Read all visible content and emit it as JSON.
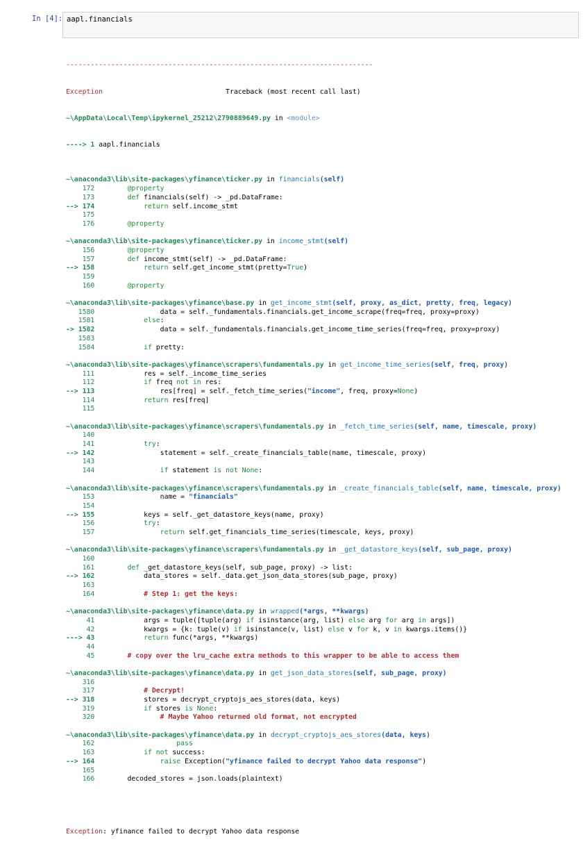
{
  "cell": {
    "prompt": "In [4]:",
    "input": "aapl.financials"
  },
  "traceback": {
    "separator": "---------------------------------------------------------------------------",
    "exception_name": "Exception",
    "traceback_header": "Traceback (most recent call last)",
    "first": {
      "path": "~\\AppData\\Local\\Temp\\ipykernel_25212\\2790889649.py",
      "in_word": " in ",
      "module": "<module>",
      "line": "----> 1 aapl.financials"
    },
    "frames": [
      {
        "path": "~\\anaconda3\\lib\\site-packages\\yfinance\\ticker.py",
        "func": "financials",
        "args": "(self)",
        "lines": [
          {
            "num": "    172",
            "code": "        @property"
          },
          {
            "num": "    173",
            "code": "        def financials(self) -> _pd.DataFrame:"
          },
          {
            "num": "--> 174",
            "code": "            return self.income_stmt",
            "current": true
          },
          {
            "num": "    175",
            "code": ""
          },
          {
            "num": "    176",
            "code": "        @property"
          }
        ]
      },
      {
        "path": "~\\anaconda3\\lib\\site-packages\\yfinance\\ticker.py",
        "func": "income_stmt",
        "args": "(self)",
        "lines": [
          {
            "num": "    156",
            "code": "        @property"
          },
          {
            "num": "    157",
            "code": "        def income_stmt(self) -> _pd.DataFrame:"
          },
          {
            "num": "--> 158",
            "code": "            return self.get_income_stmt(pretty=True)",
            "current": true
          },
          {
            "num": "    159",
            "code": ""
          },
          {
            "num": "    160",
            "code": "        @property"
          }
        ]
      },
      {
        "path": "~\\anaconda3\\lib\\site-packages\\yfinance\\base.py",
        "func": "get_income_stmt",
        "args": "(self, proxy, as_dict, pretty, freq, legacy)",
        "lines": [
          {
            "num": "   1580",
            "code": "                data = self._fundamentals.financials.get_income_scrape(freq=freq, proxy=proxy)"
          },
          {
            "num": "   1581",
            "code": "            else:"
          },
          {
            "num": "-> 1582",
            "code": "                data = self._fundamentals.financials.get_income_time_series(freq=freq, proxy=proxy)",
            "current": true
          },
          {
            "num": "   1583",
            "code": ""
          },
          {
            "num": "   1584",
            "code": "            if pretty:"
          }
        ]
      },
      {
        "path": "~\\anaconda3\\lib\\site-packages\\yfinance\\scrapers\\fundamentals.py",
        "func": "get_income_time_series",
        "args": "(self, freq, proxy)",
        "lines": [
          {
            "num": "    111",
            "code": "            res = self._income_time_series"
          },
          {
            "num": "    112",
            "code": "            if freq not in res:"
          },
          {
            "num": "--> 113",
            "code": "                res[freq] = self._fetch_time_series(\"income\", freq, proxy=None)",
            "current": true
          },
          {
            "num": "    114",
            "code": "            return res[freq]"
          },
          {
            "num": "    115",
            "code": ""
          }
        ]
      },
      {
        "path": "~\\anaconda3\\lib\\site-packages\\yfinance\\scrapers\\fundamentals.py",
        "func": "_fetch_time_series",
        "args": "(self, name, timescale, proxy)",
        "lines": [
          {
            "num": "    140",
            "code": ""
          },
          {
            "num": "    141",
            "code": "            try:"
          },
          {
            "num": "--> 142",
            "code": "                statement = self._create_financials_table(name, timescale, proxy)",
            "current": true
          },
          {
            "num": "    143",
            "code": ""
          },
          {
            "num": "    144",
            "code": "                if statement is not None:"
          }
        ]
      },
      {
        "path": "~\\anaconda3\\lib\\site-packages\\yfinance\\scrapers\\fundamentals.py",
        "func": "_create_financials_table",
        "args": "(self, name, timescale, proxy)",
        "lines": [
          {
            "num": "    153",
            "code": "                name = \"financials\""
          },
          {
            "num": "    154",
            "code": ""
          },
          {
            "num": "--> 155",
            "code": "            keys = self._get_datastore_keys(name, proxy)",
            "current": true
          },
          {
            "num": "    156",
            "code": "            try:"
          },
          {
            "num": "    157",
            "code": "                return self.get_financials_time_series(timescale, keys, proxy)"
          }
        ]
      },
      {
        "path": "~\\anaconda3\\lib\\site-packages\\yfinance\\scrapers\\fundamentals.py",
        "func": "_get_datastore_keys",
        "args": "(self, sub_page, proxy)",
        "lines": [
          {
            "num": "    160",
            "code": ""
          },
          {
            "num": "    161",
            "code": "        def _get_datastore_keys(self, sub_page, proxy) -> list:"
          },
          {
            "num": "--> 162",
            "code": "            data_stores = self._data.get_json_data_stores(sub_page, proxy)",
            "current": true
          },
          {
            "num": "    163",
            "code": ""
          },
          {
            "num": "    164",
            "code": "            # Step 1: get the keys:"
          }
        ]
      },
      {
        "path": "~\\anaconda3\\lib\\site-packages\\yfinance\\data.py",
        "func": "wrapped",
        "args": "(*args, **kwargs)",
        "lines": [
          {
            "num": "     41",
            "code": "            args = tuple([tuple(arg) if isinstance(arg, list) else arg for arg in args])"
          },
          {
            "num": "     42",
            "code": "            kwargs = {k: tuple(v) if isinstance(v, list) else v for k, v in kwargs.items()}"
          },
          {
            "num": "---> 43",
            "code": "            return func(*args, **kwargs)",
            "current": true
          },
          {
            "num": "     44",
            "code": ""
          },
          {
            "num": "     45",
            "code": "        # copy over the lru_cache extra methods to this wrapper to be able to access them"
          }
        ]
      },
      {
        "path": "~\\anaconda3\\lib\\site-packages\\yfinance\\data.py",
        "func": "get_json_data_stores",
        "args": "(self, sub_page, proxy)",
        "lines": [
          {
            "num": "    316",
            "code": ""
          },
          {
            "num": "    317",
            "code": "            # Decrypt!"
          },
          {
            "num": "--> 318",
            "code": "            stores = decrypt_cryptojs_aes_stores(data, keys)",
            "current": true
          },
          {
            "num": "    319",
            "code": "            if stores is None:"
          },
          {
            "num": "    320",
            "code": "                # Maybe Yahoo returned old format, not encrypted"
          }
        ]
      },
      {
        "path": "~\\anaconda3\\lib\\site-packages\\yfinance\\data.py",
        "func": "decrypt_cryptojs_aes_stores",
        "args": "(data, keys)",
        "lines": [
          {
            "num": "    162",
            "code": "                    pass"
          },
          {
            "num": "    163",
            "code": "            if not success:"
          },
          {
            "num": "--> 164",
            "code": "                raise Exception(\"yfinance failed to decrypt Yahoo data response\")",
            "current": true
          },
          {
            "num": "    165",
            "code": ""
          },
          {
            "num": "    166",
            "code": "        decoded_stores = json.loads(plaintext)"
          }
        ]
      }
    ],
    "final": {
      "exception_name": "Exception",
      "message": ": yfinance failed to decrypt Yahoo data response"
    }
  }
}
